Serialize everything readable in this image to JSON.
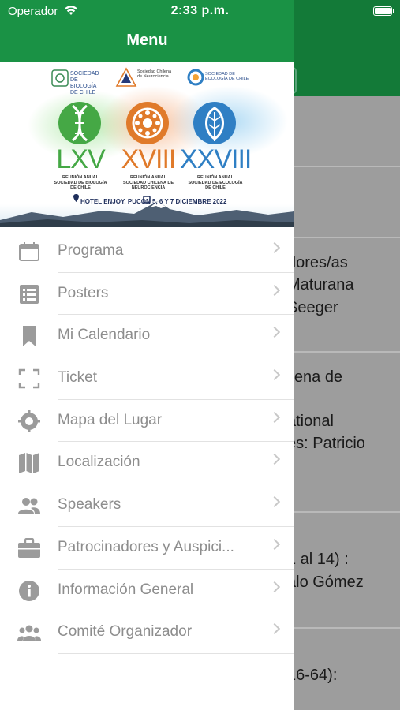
{
  "status_bar": {
    "carrier": "Operador",
    "time": "2:33 p.m."
  },
  "background_content": {
    "lines": [
      "dores/as",
      "Maturana",
      "Seeger",
      "ilena de",
      "ational",
      "es: Patricio",
      "1 al 14) :",
      "alo Gómez",
      "16-64):"
    ]
  },
  "drawer": {
    "title": "Menu",
    "banner": {
      "logos": [
        "SOCIEDAD DE BIOLOGÍA DE CHILE",
        "Sociedad Chilena de Neurociencia",
        "SOCIEDAD DE ECOLOGÍA DE CHILE"
      ],
      "meetings": [
        {
          "roman": "LXV",
          "subtitle": "REUNIÓN ANUAL SOCIEDAD DE BIOLOGÍA DE CHILE",
          "color": "#45a845"
        },
        {
          "roman": "XVIII",
          "subtitle": "REUNIÓN ANUAL SOCIEDAD CHILENA DE NEUROCIENCIA",
          "color": "#e07a2a"
        },
        {
          "roman": "XXVIII",
          "subtitle": "REUNIÓN ANUAL SOCIEDAD DE ECOLOGÍA DE CHILE",
          "color": "#2f7fc4"
        }
      ],
      "location": "HOTEL ENJOY, PUCÓN",
      "dates": "5, 6 Y 7 DICIEMBRE 2022"
    },
    "menu_items": [
      {
        "label": "Programa",
        "icon": "calendar-icon"
      },
      {
        "label": "Posters",
        "icon": "list-icon"
      },
      {
        "label": "Mi Calendario",
        "icon": "bookmark-icon"
      },
      {
        "label": "Ticket",
        "icon": "scan-frame-icon"
      },
      {
        "label": "Mapa del Lugar",
        "icon": "location-target-icon"
      },
      {
        "label": "Localización",
        "icon": "map-icon"
      },
      {
        "label": "Speakers",
        "icon": "people-icon"
      },
      {
        "label": "Patrocinadores y Auspici...",
        "icon": "briefcase-icon"
      },
      {
        "label": "Información General",
        "icon": "info-icon"
      },
      {
        "label": "Comité Organizador",
        "icon": "group-icon"
      }
    ]
  },
  "colors": {
    "header_green": "#1a9245",
    "icon_gray": "#9b9b9b",
    "label_gray": "#8d8d8d",
    "overlay_gray": "#9d9d9d"
  }
}
